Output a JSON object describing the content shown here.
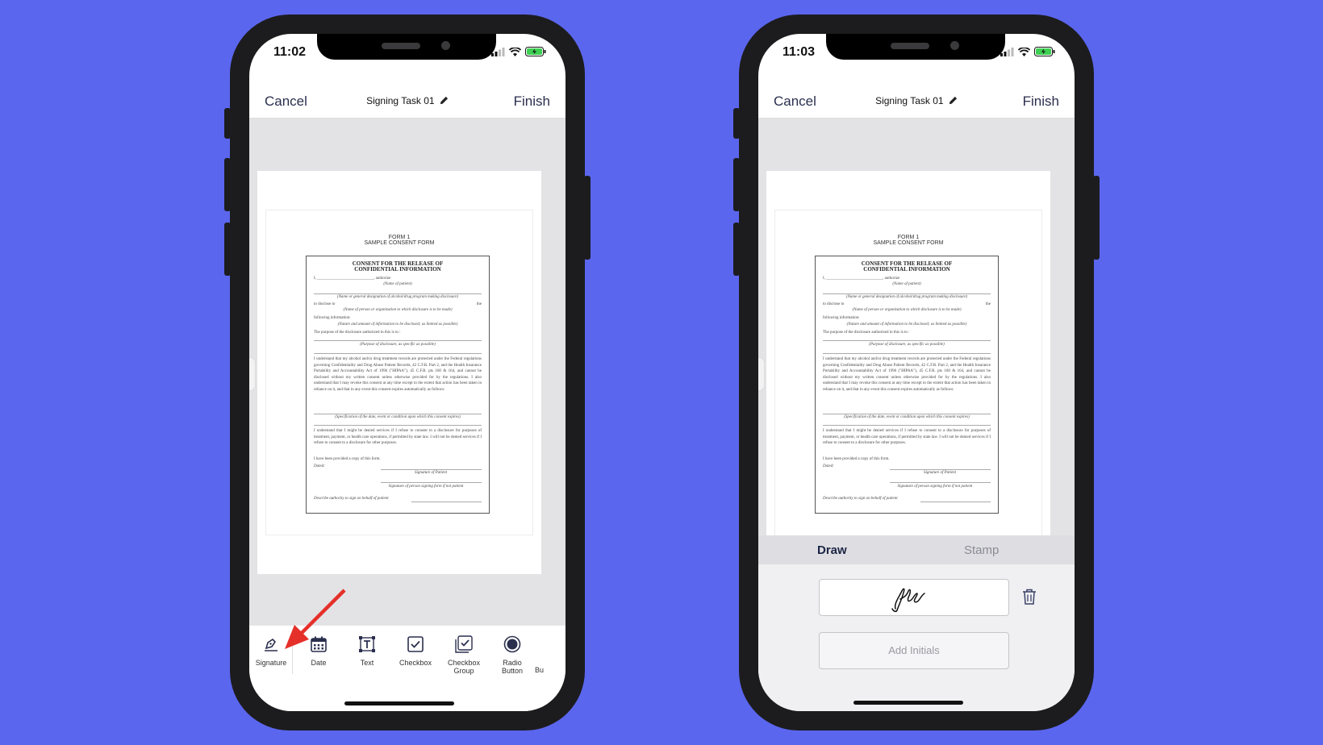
{
  "colors": {
    "background": "#5b66ee",
    "nav_text": "#2a2f4e",
    "battery": "#3ecf53",
    "arrow": "#e5302a"
  },
  "left_phone": {
    "time": "11:02",
    "nav": {
      "cancel": "Cancel",
      "title": "Signing Task 01",
      "finish": "Finish"
    },
    "toolbar": [
      {
        "label": "Signature",
        "icon": "signature-pen-icon"
      },
      {
        "label": "Date",
        "icon": "calendar-icon"
      },
      {
        "label": "Text",
        "icon": "text-box-icon"
      },
      {
        "label": "Checkbox",
        "icon": "checkbox-icon"
      },
      {
        "label": "Checkbox Group",
        "icon": "checkbox-group-icon"
      },
      {
        "label": "Radio Button",
        "icon": "radio-button-icon"
      },
      {
        "label": "Bu",
        "icon": ""
      }
    ]
  },
  "right_phone": {
    "time": "11:03",
    "nav": {
      "cancel": "Cancel",
      "title": "Signing Task 01",
      "finish": "Finish"
    },
    "tabs": {
      "draw": "Draw",
      "stamp": "Stamp"
    },
    "add_initials": "Add Initials"
  },
  "document": {
    "form_label": "FORM 1",
    "form_name": "SAMPLE CONSENT FORM",
    "title_line1": "CONSENT FOR THE RELEASE OF",
    "title_line2": "CONFIDENTIAL INFORMATION",
    "authorize": "I, ____________________________, authorize",
    "name_of_patient": "(Name of patient)",
    "general_designation": "(Name or general designation of alcohol/drug program making disclosure)",
    "disclose_to": "to disclose to",
    "the": "the",
    "person_org": "(Name of person or organization to which disclosure is to be made)",
    "following": "following information:",
    "nature_amount": "(Nature and amount of information to be disclosed; as limited as possible)",
    "purpose_line": "The purpose of the disclosure authorized in this is to :",
    "purpose_hint": "(Purpose of disclosure, as specific as possible)",
    "paragraph1": "I understand that my alcohol and/or drug treatment records are protected under the Federal regulations governing Confidentiality and Drug Abuse Patient Records, 42 C.F.R. Part 2, and the Health Insurance Portability and Accountability Act of 1996 (\"HIPAA\"), 45 C.F.R. pts 160 & 164, and cannot be disclosed without my written consent unless otherwise provided for by the regulations. I also understand that I may revoke this consent at any time except to the extent that action has been taken in reliance on it, and that in any event this consent expires automatically as follows:",
    "specification": "(Specification of the date, event or condition upon which this consent expires)",
    "paragraph2": "I understand that I might be denied services if I refuse to consent to a disclosure for purposes of treatment, payment, or health care operations, if permitted by state law. I will not be denied services if I refuse to consent to a disclosure for other purposes.",
    "copy_line": "I have been provided a copy of this form.",
    "dated": "Dated:",
    "signature_patient": "Signature of Patient",
    "signature_person": "Signature of person signing form if not patient",
    "describe_authority": "Describe authority to sign on behalf of patient"
  }
}
